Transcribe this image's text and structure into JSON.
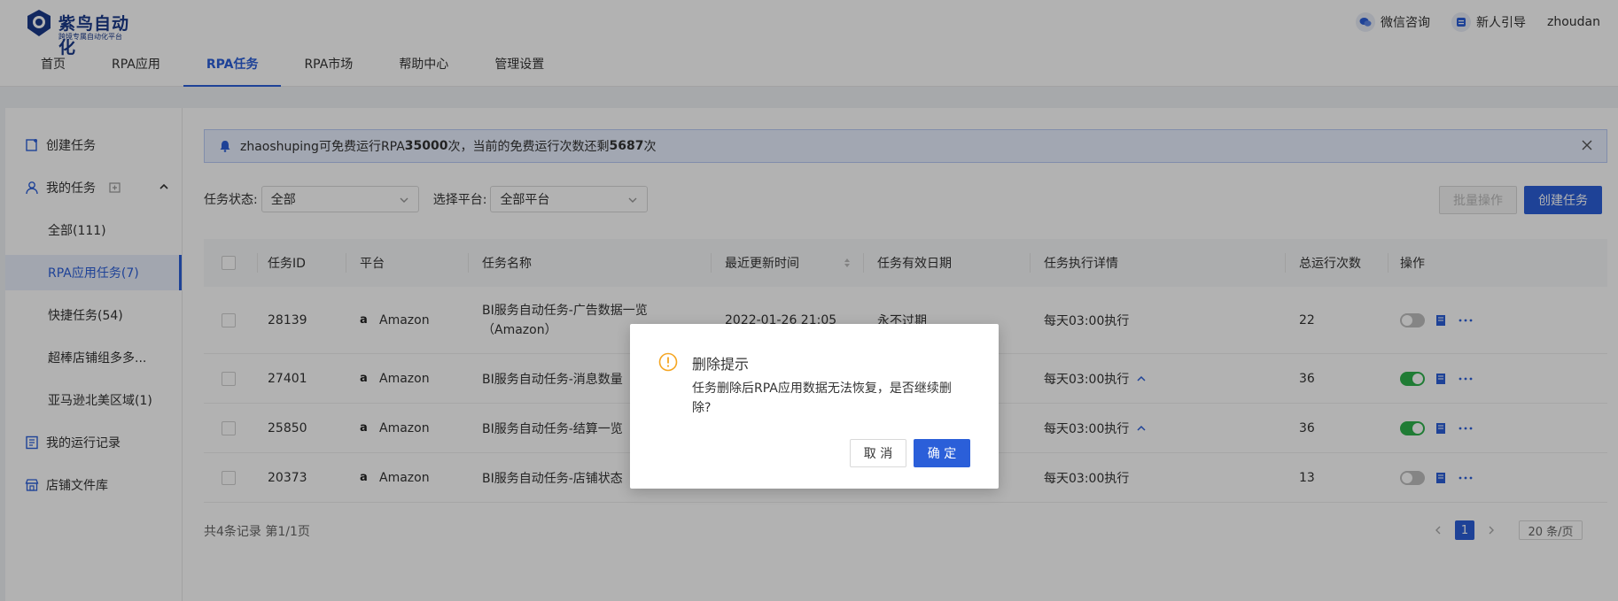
{
  "header": {
    "logo_title": "紫鸟自动化",
    "logo_subtitle": "跨境专属自动化平台",
    "wechat": "微信咨询",
    "guide": "新人引导",
    "user": "zhoudan"
  },
  "nav": {
    "tabs": [
      {
        "label": "首页"
      },
      {
        "label": "RPA应用"
      },
      {
        "label": "RPA任务"
      },
      {
        "label": "RPA市场"
      },
      {
        "label": "帮助中心"
      },
      {
        "label": "管理设置"
      }
    ]
  },
  "sidebar": {
    "create_task": "创建任务",
    "my_tasks": "我的任务",
    "items": [
      {
        "label": "全部(111)"
      },
      {
        "label": "RPA应用任务(7)"
      },
      {
        "label": "快捷任务(54)"
      },
      {
        "label": "超棒店铺组多多..."
      },
      {
        "label": "亚马逊北美区域(1)"
      }
    ],
    "run_records": "我的运行记录",
    "shop_files": "店铺文件库"
  },
  "notice": {
    "prefix": "zhaoshuping可免费运行RPA ",
    "total": "35000",
    "middle": " 次，当前的免费运行次数还剩 ",
    "remaining": "5687",
    "suffix": " 次"
  },
  "filters": {
    "status_label": "任务状态:",
    "status_value": "全部",
    "platform_label": "选择平台:",
    "platform_value": "全部平台",
    "batch": "批量操作",
    "create": "创建任务"
  },
  "table": {
    "headers": {
      "id": "任务ID",
      "platform": "平台",
      "name": "任务名称",
      "updated": "最近更新时间",
      "validity": "任务有效日期",
      "schedule": "任务执行详情",
      "runs": "总运行次数",
      "ops": "操作"
    },
    "rows": [
      {
        "id": "28139",
        "platform": "Amazon",
        "name": "BI服务自动任务-广告数据一览",
        "name2": "（Amazon）",
        "updated": "2022-01-26 21:05",
        "validity": "永不过期",
        "schedule": "每天03:00执行",
        "runs": "22",
        "enabled": false
      },
      {
        "id": "27401",
        "platform": "Amazon",
        "name": "BI服务自动任务-消息数量",
        "schedule": "每天03:00执行",
        "runs": "36",
        "enabled": true
      },
      {
        "id": "25850",
        "platform": "Amazon",
        "name": "BI服务自动任务-结算一览",
        "schedule": "每天03:00执行",
        "runs": "36",
        "enabled": true
      },
      {
        "id": "20373",
        "platform": "Amazon",
        "name": "BI服务自动任务-店铺状态",
        "schedule": "每天03:00执行",
        "runs": "13",
        "enabled": false
      }
    ]
  },
  "footer": {
    "count": "共4条记录 第1/1页",
    "page": "1",
    "page_size": "20 条/页"
  },
  "dialog": {
    "title": "删除提示",
    "message": "任务删除后RPA应用数据无法恢复，是否继续删除?",
    "cancel": "取 消",
    "ok": "确 定"
  },
  "colors": {
    "primary": "#2b5fd9",
    "toggle_on": "#2fb24c",
    "warning": "#f5a623"
  }
}
